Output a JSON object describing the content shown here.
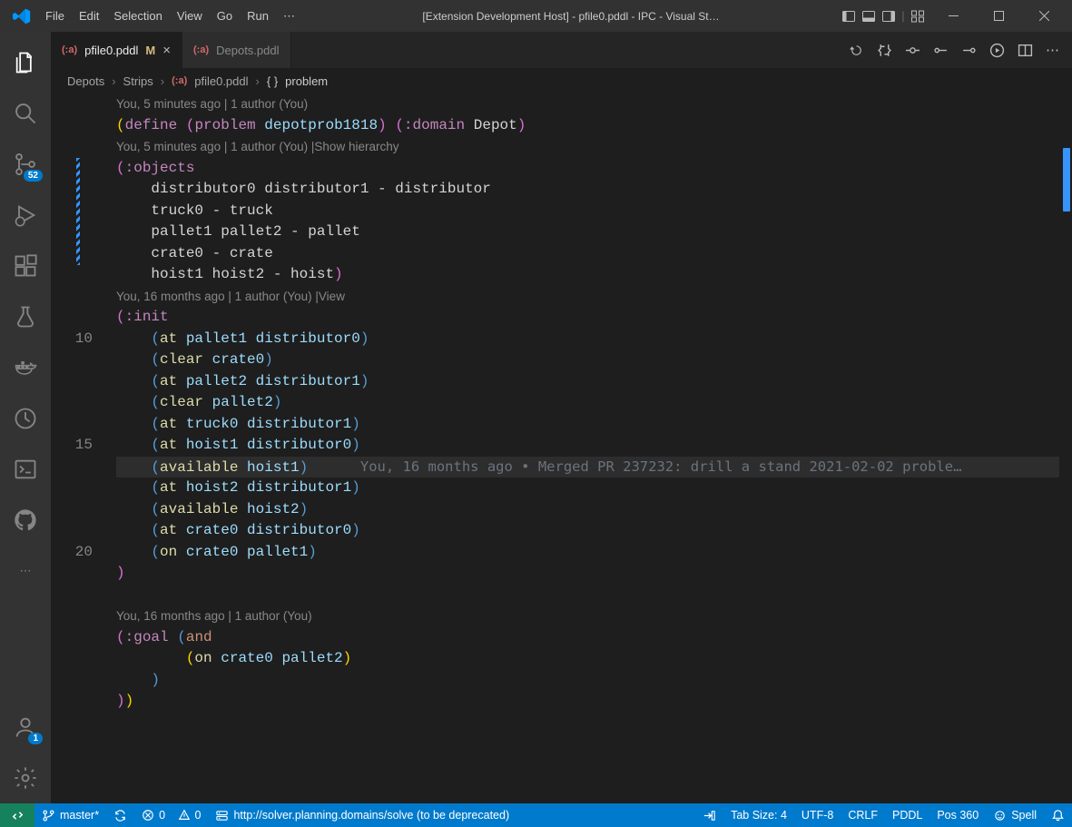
{
  "titlebar": {
    "menu": [
      "File",
      "Edit",
      "Selection",
      "View",
      "Go",
      "Run"
    ],
    "title": "[Extension Development Host] - pfile0.pddl - IPC - Visual St…"
  },
  "activity": {
    "scm_badge": "52",
    "accounts_badge": "1"
  },
  "tabs": {
    "active": {
      "icon": "(:a)",
      "name": "pfile0.pddl",
      "mod": "M"
    },
    "other": {
      "icon": "(:a)",
      "name": "Depots.pddl"
    }
  },
  "breadcrumbs": {
    "p1": "Depots",
    "p2": "Strips",
    "icon": "(:a)",
    "file": "pfile0.pddl",
    "sym": "problem"
  },
  "lenses": {
    "l1": "You, 5 minutes ago | 1 author (You)",
    "l2a": "You, 5 minutes ago | 1 author (You) | ",
    "l2b": "Show hierarchy",
    "l3a": "You, 16 months ago | 1 author (You) | ",
    "l3b": "View",
    "l4": "You, 16 months ago | 1 author (You)"
  },
  "blame": "You, 16 months ago • Merged PR 237232: drill a stand 2021-02-02 proble…",
  "gutter": {
    "n10": "10",
    "n15": "15",
    "n20": "20"
  },
  "code": {
    "define": "define",
    "problem": "problem",
    "probname": "depotprob1818",
    "domainkw": ":domain",
    "domainname": "Depot",
    "objects": ":objects",
    "obj1a": "distributor0 distributor1 ",
    "obj1b": "- distributor",
    "obj2a": "truck0 ",
    "obj2b": "- truck",
    "obj3a": "pallet1 pallet2 ",
    "obj3b": "- pallet",
    "obj4a": "crate0 ",
    "obj4b": "- crate",
    "obj5a": "hoist1 hoist2 ",
    "obj5b": "- hoist",
    "init": ":init",
    "p1a": "at ",
    "p1b": "pallet1 distributor0",
    "p2a": "clear ",
    "p2b": "crate0",
    "p3a": "at ",
    "p3b": "pallet2 distributor1",
    "p4a": "clear ",
    "p4b": "pallet2",
    "p5a": "at ",
    "p5b": "truck0 distributor1",
    "p6a": "at ",
    "p6b": "hoist1 distributor0",
    "p7a": "available ",
    "p7b": "hoist1",
    "p8a": "at ",
    "p8b": "hoist2 distributor1",
    "p9a": "available ",
    "p9b": "hoist2",
    "p10a": "at ",
    "p10b": "crate0 distributor0",
    "p11a": "on ",
    "p11b": "crate0 pallet1",
    "goal": ":goal",
    "and": "and",
    "g1a": "on ",
    "g1b": "crate0 pallet2"
  },
  "status": {
    "branch": "master*",
    "errors": "0",
    "warnings": "0",
    "server": "http://solver.planning.domains/solve (to be deprecated)",
    "tabsize": "Tab Size: 4",
    "encoding": "UTF-8",
    "eol": "CRLF",
    "lang": "PDDL",
    "pos": "Pos 360",
    "spell": "Spell"
  }
}
